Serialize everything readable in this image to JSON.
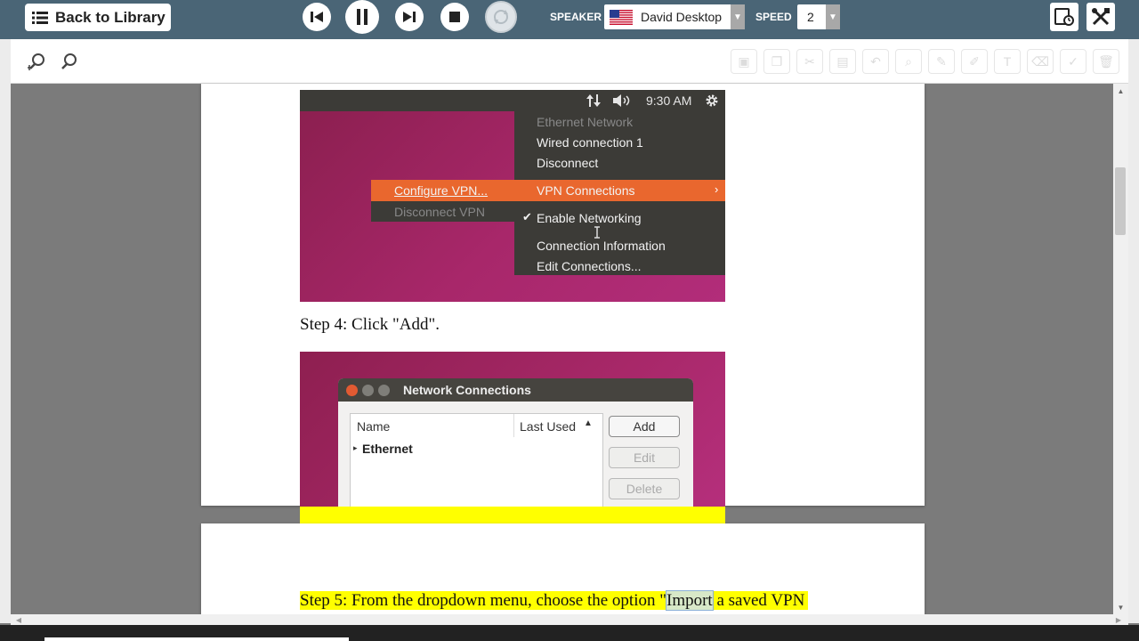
{
  "toolbar": {
    "back_label": "Back to Library",
    "speaker_label": "SPEAKER",
    "speaker_value": "David Desktop",
    "speed_label": "SPEED",
    "speed_value": "2"
  },
  "icons": {
    "back": "list-icon",
    "prev": "skip-previous-icon",
    "pause": "pause-icon",
    "next": "skip-next-icon",
    "stop": "stop-icon",
    "sync": "sync-icon",
    "flag": "us-flag-icon",
    "screen": "screen-clock-icon",
    "tools": "tools-icon",
    "zoom_in": "zoom-in-icon",
    "zoom_out": "zoom-out-icon"
  },
  "colors": {
    "topbar": "#4a6576",
    "highlight_orange": "#e9672e",
    "highlight_yellow": "#ffff00"
  },
  "screenshot1": {
    "clock": "9:30 AM",
    "menu": {
      "ethernet_network": "Ethernet Network",
      "wired": "Wired connection 1",
      "disconnect": "Disconnect",
      "vpn": "VPN Connections",
      "enable_networking": "Enable Networking",
      "connection_info": "Connection Information",
      "edit_connections": "Edit Connections..."
    },
    "submenu": {
      "configure": "Configure VPN...",
      "disconnect_vpn": "Disconnect VPN"
    }
  },
  "step4": "Step 4: Click \"Add\".",
  "screenshot2": {
    "title": "Network Connections",
    "col_name": "Name",
    "col_last_used": "Last Used",
    "row_ethernet": "Ethernet",
    "btn_add": "Add",
    "btn_edit": "Edit",
    "btn_delete": "Delete"
  },
  "step5": {
    "before": "Step 5: From the dropdown menu, choose the option \"",
    "highlighted_word": "Import",
    "after": " a saved VPN"
  }
}
